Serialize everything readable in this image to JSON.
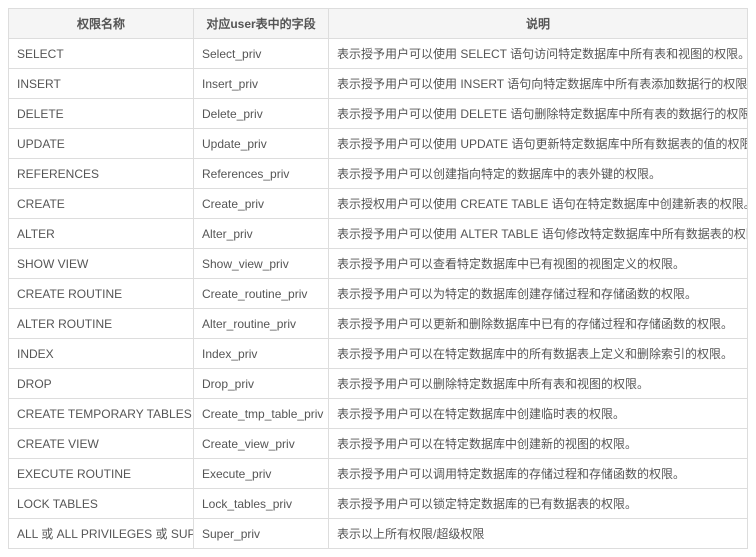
{
  "headers": {
    "col1": "权限名称",
    "col2": "对应user表中的字段",
    "col3": "说明"
  },
  "rows": [
    {
      "name": "SELECT",
      "field": "Select_priv",
      "desc": "表示授予用户可以使用 SELECT 语句访问特定数据库中所有表和视图的权限。"
    },
    {
      "name": "INSERT",
      "field": "Insert_priv",
      "desc": "表示授予用户可以使用 INSERT 语句向特定数据库中所有表添加数据行的权限。"
    },
    {
      "name": "DELETE",
      "field": "Delete_priv",
      "desc": "表示授予用户可以使用 DELETE 语句删除特定数据库中所有表的数据行的权限。"
    },
    {
      "name": "UPDATE",
      "field": "Update_priv",
      "desc": "表示授予用户可以使用 UPDATE 语句更新特定数据库中所有数据表的值的权限。"
    },
    {
      "name": "REFERENCES",
      "field": "References_priv",
      "desc": "表示授予用户可以创建指向特定的数据库中的表外键的权限。"
    },
    {
      "name": "CREATE",
      "field": "Create_priv",
      "desc": "表示授权用户可以使用 CREATE TABLE 语句在特定数据库中创建新表的权限。"
    },
    {
      "name": "ALTER",
      "field": "Alter_priv",
      "desc": "表示授予用户可以使用 ALTER TABLE 语句修改特定数据库中所有数据表的权限。"
    },
    {
      "name": "SHOW VIEW",
      "field": "Show_view_priv",
      "desc": "表示授予用户可以查看特定数据库中已有视图的视图定义的权限。"
    },
    {
      "name": "CREATE ROUTINE",
      "field": "Create_routine_priv",
      "desc": "表示授予用户可以为特定的数据库创建存储过程和存储函数的权限。"
    },
    {
      "name": "ALTER ROUTINE",
      "field": "Alter_routine_priv",
      "desc": "表示授予用户可以更新和删除数据库中已有的存储过程和存储函数的权限。"
    },
    {
      "name": "INDEX",
      "field": "Index_priv",
      "desc": "表示授予用户可以在特定数据库中的所有数据表上定义和删除索引的权限。"
    },
    {
      "name": "DROP",
      "field": "Drop_priv",
      "desc": "表示授予用户可以删除特定数据库中所有表和视图的权限。"
    },
    {
      "name": "CREATE TEMPORARY TABLES",
      "field": "Create_tmp_table_priv",
      "desc": "表示授予用户可以在特定数据库中创建临时表的权限。"
    },
    {
      "name": "CREATE VIEW",
      "field": "Create_view_priv",
      "desc": "表示授予用户可以在特定数据库中创建新的视图的权限。"
    },
    {
      "name": "EXECUTE ROUTINE",
      "field": "Execute_priv",
      "desc": "表示授予用户可以调用特定数据库的存储过程和存储函数的权限。"
    },
    {
      "name": "LOCK TABLES",
      "field": "Lock_tables_priv",
      "desc": "表示授予用户可以锁定特定数据库的已有数据表的权限。"
    },
    {
      "name": "ALL 或 ALL PRIVILEGES 或 SUPER",
      "field": "Super_priv",
      "desc": "表示以上所有权限/超级权限"
    }
  ]
}
